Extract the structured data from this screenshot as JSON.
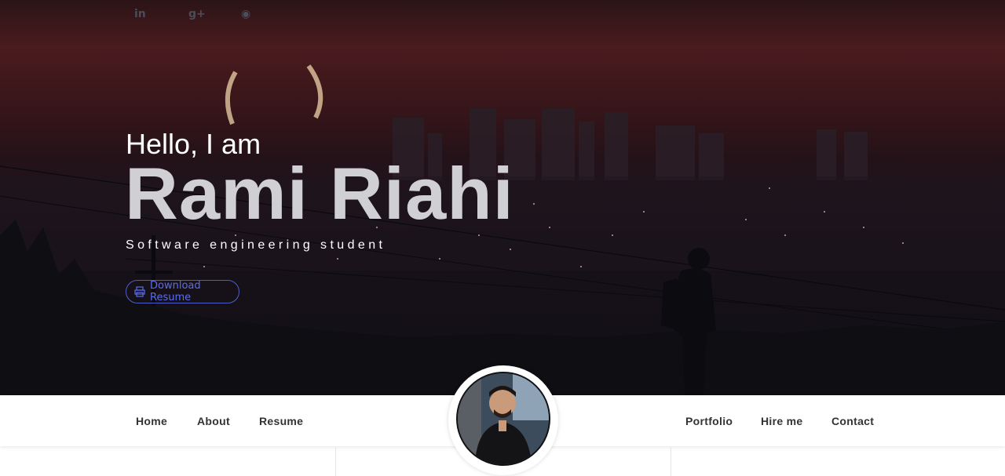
{
  "social": {
    "linkedin": {
      "icon": "linkedin-icon",
      "glyph": "in"
    },
    "gplus": {
      "icon": "google-plus-icon",
      "glyph": "g+"
    },
    "github": {
      "icon": "github-icon",
      "glyph": "◉"
    }
  },
  "hero": {
    "greeting": "Hello, I am",
    "name": "Rami Riahi",
    "subtitle": "Software engineering student",
    "download_button": {
      "label": "Download Resume",
      "icon": "print-icon"
    }
  },
  "nav": {
    "left": [
      {
        "label": "Home"
      },
      {
        "label": "About"
      },
      {
        "label": "Resume"
      }
    ],
    "right": [
      {
        "label": "Portfolio"
      },
      {
        "label": "Hire me"
      },
      {
        "label": "Contact"
      }
    ]
  },
  "colors": {
    "accent": "#5b6cf0",
    "name_text": "#d0cfd3",
    "nav_text": "#333333"
  }
}
